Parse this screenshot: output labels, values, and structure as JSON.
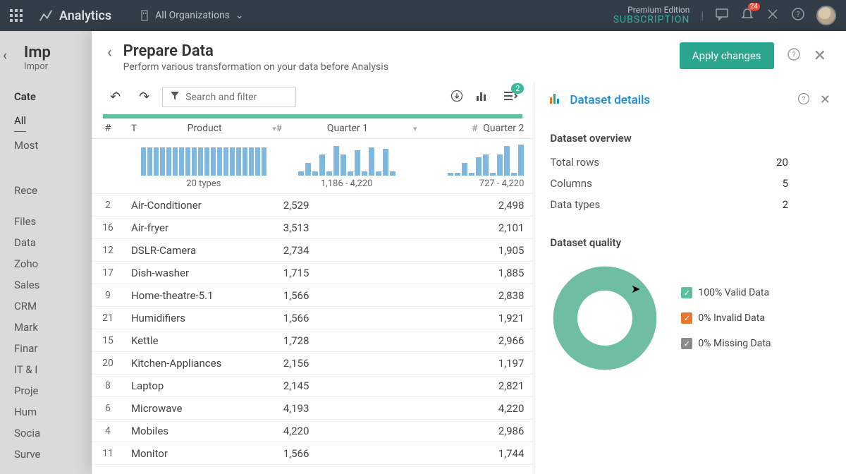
{
  "topbar": {
    "brand": "Analytics",
    "org_label": "All Organizations",
    "subscription_line1": "Premium Edition",
    "subscription_line2": "SUBSCRIPTION",
    "notification_count": "24"
  },
  "bg_sidebar": {
    "title": "Imp",
    "subtitle": "Impor",
    "section": "Cate",
    "items": [
      "All",
      "Most",
      "Rece",
      "Files",
      "Data",
      "Zoho",
      "Sales",
      "CRM",
      "Mark",
      "Finar",
      "IT & I",
      "Proje",
      "Hum",
      "Socia",
      "Surve"
    ]
  },
  "modal": {
    "title": "Prepare Data",
    "subtitle": "Perform various transformation on your data before Analysis",
    "apply_label": "Apply changes",
    "search_placeholder": "Search and filter",
    "toolbar_badge": "2"
  },
  "table": {
    "columns": {
      "index": "#",
      "type_icon": "T",
      "product": "Product",
      "q1_icon": "#",
      "q1": "Quarter 1",
      "q2_icon": "#",
      "q2": "Quarter 2"
    },
    "hist_labels": {
      "product": "20 types",
      "q1": "1,186 - 4,220",
      "q2": "727 - 4,220"
    },
    "rows": [
      {
        "n": "2",
        "product": "Air-Conditioner",
        "q1": "2,529",
        "q2": "2,498"
      },
      {
        "n": "16",
        "product": "Air-fryer",
        "q1": "3,513",
        "q2": "2,101"
      },
      {
        "n": "12",
        "product": "DSLR-Camera",
        "q1": "2,734",
        "q2": "1,905"
      },
      {
        "n": "17",
        "product": "Dish-washer",
        "q1": "1,715",
        "q2": "1,885"
      },
      {
        "n": "9",
        "product": "Home-theatre-5.1",
        "q1": "1,566",
        "q2": "2,838"
      },
      {
        "n": "21",
        "product": "Humidifiers",
        "q1": "1,566",
        "q2": "1,921"
      },
      {
        "n": "15",
        "product": "Kettle",
        "q1": "1,728",
        "q2": "2,966"
      },
      {
        "n": "20",
        "product": "Kitchen-Appliances",
        "q1": "2,156",
        "q2": "1,197"
      },
      {
        "n": "8",
        "product": "Laptop",
        "q1": "2,145",
        "q2": "2,821"
      },
      {
        "n": "6",
        "product": "Microwave",
        "q1": "4,193",
        "q2": "4,220"
      },
      {
        "n": "4",
        "product": "Mobiles",
        "q1": "4,220",
        "q2": "2,986"
      },
      {
        "n": "11",
        "product": "Monitor",
        "q1": "1,566",
        "q2": "1,744"
      }
    ]
  },
  "details": {
    "title": "Dataset details",
    "overview_title": "Dataset overview",
    "overview": [
      {
        "label": "Total rows",
        "value": "20"
      },
      {
        "label": "Columns",
        "value": "5"
      },
      {
        "label": "Data types",
        "value": "2"
      }
    ],
    "quality_title": "Dataset quality",
    "legend": [
      {
        "label": "100% Valid Data",
        "color": "green"
      },
      {
        "label": "0% Invalid Data",
        "color": "orange"
      },
      {
        "label": "0% Missing Data",
        "color": "gray"
      }
    ]
  },
  "chart_data": {
    "type": "pie",
    "title": "Dataset quality",
    "series": [
      {
        "name": "Valid Data",
        "value": 100
      },
      {
        "name": "Invalid Data",
        "value": 0
      },
      {
        "name": "Missing Data",
        "value": 0
      }
    ]
  }
}
